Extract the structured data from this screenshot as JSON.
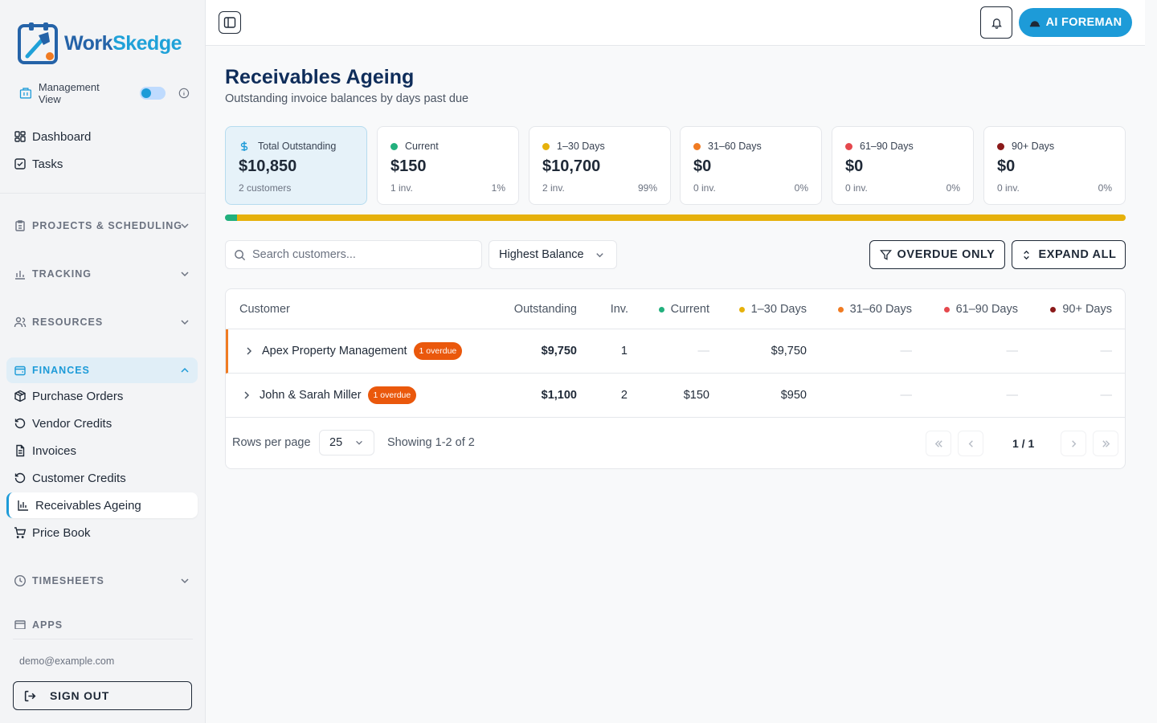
{
  "app": {
    "logo_text_a": "Work",
    "logo_text_b": "Skedge",
    "management_view_label": "Management View",
    "management_view_on": true
  },
  "sidebar": {
    "top_items": [
      {
        "label": "Dashboard",
        "icon": "dashboard-icon"
      },
      {
        "label": "Tasks",
        "icon": "checkbox-icon"
      }
    ],
    "sections": [
      {
        "label": "PROJECTS & SCHEDULING",
        "icon": "clipboard-icon",
        "open": false
      },
      {
        "label": "TRACKING",
        "icon": "bar-chart-icon",
        "open": false
      },
      {
        "label": "RESOURCES",
        "icon": "users-icon",
        "open": false
      },
      {
        "label": "FINANCES",
        "icon": "wallet-icon",
        "open": true
      },
      {
        "label": "TIMESHEETS",
        "icon": "clock-icon",
        "open": false
      },
      {
        "label": "APPS",
        "icon": "apps-icon",
        "open": false
      }
    ],
    "finance_items": [
      {
        "label": "Purchase Orders",
        "icon": "package-icon"
      },
      {
        "label": "Vendor Credits",
        "icon": "rotate-icon"
      },
      {
        "label": "Invoices",
        "icon": "document-icon"
      },
      {
        "label": "Customer Credits",
        "icon": "rotate-icon"
      },
      {
        "label": "Receivables Ageing",
        "icon": "bar-chart-icon",
        "active": true
      },
      {
        "label": "Price Book",
        "icon": "cart-icon"
      }
    ],
    "email": "demo@example.com",
    "sign_out_label": "SIGN OUT"
  },
  "topbar": {
    "ai_button_label": "AI FOREMAN"
  },
  "page": {
    "title": "Receivables Ageing",
    "subtitle": "Outstanding invoice balances by days past due"
  },
  "summary_cards": [
    {
      "label": "Total Outstanding",
      "value": "$10,850",
      "sub": "2 customers",
      "pct": "",
      "color": "#1d9bd8"
    },
    {
      "label": "Current",
      "value": "$150",
      "sub": "1 inv.",
      "pct": "1%",
      "color": "#22b07d"
    },
    {
      "label": "1–30 Days",
      "value": "$10,700",
      "sub": "2 inv.",
      "pct": "99%",
      "color": "#e6b10b"
    },
    {
      "label": "31–60 Days",
      "value": "$0",
      "sub": "0 inv.",
      "pct": "0%",
      "color": "#f07b22"
    },
    {
      "label": "61–90 Days",
      "value": "$0",
      "sub": "0 inv.",
      "pct": "0%",
      "color": "#e5484d"
    },
    {
      "label": "90+ Days",
      "value": "$0",
      "sub": "0 inv.",
      "pct": "0%",
      "color": "#8b1a1a"
    }
  ],
  "distribution": [
    {
      "bucket": "Current",
      "fraction": 0.0138,
      "color": "#22b07d"
    },
    {
      "bucket": "1–30 Days",
      "fraction": 0.9862,
      "color": "#e6b10b"
    }
  ],
  "toolbar": {
    "search_placeholder": "Search customers...",
    "sort_value": "Highest Balance",
    "overdue_only_label": "OVERDUE ONLY",
    "expand_all_label": "EXPAND ALL"
  },
  "table": {
    "headers": {
      "customer": "Customer",
      "outstanding": "Outstanding",
      "inv": "Inv.",
      "current": "Current",
      "d1_30": "1–30 Days",
      "d31_60": "31–60 Days",
      "d61_90": "61–90 Days",
      "d90": "90+ Days"
    },
    "rows": [
      {
        "customer": "Apex Property Management",
        "badge": "1 overdue",
        "outstanding": "$9,750",
        "inv": "1",
        "current": "—",
        "d1_30": "$9,750",
        "d31_60": "—",
        "d61_90": "—",
        "d90": "—"
      },
      {
        "customer": "John & Sarah Miller",
        "badge": "1 overdue",
        "outstanding": "$1,100",
        "inv": "2",
        "current": "$150",
        "d1_30": "$950",
        "d31_60": "—",
        "d61_90": "—",
        "d90": "—"
      }
    ],
    "rows_per_page_label": "Rows per page",
    "rows_per_page": "25",
    "showing": "Showing 1-2 of 2",
    "page_indicator": "1 / 1"
  }
}
